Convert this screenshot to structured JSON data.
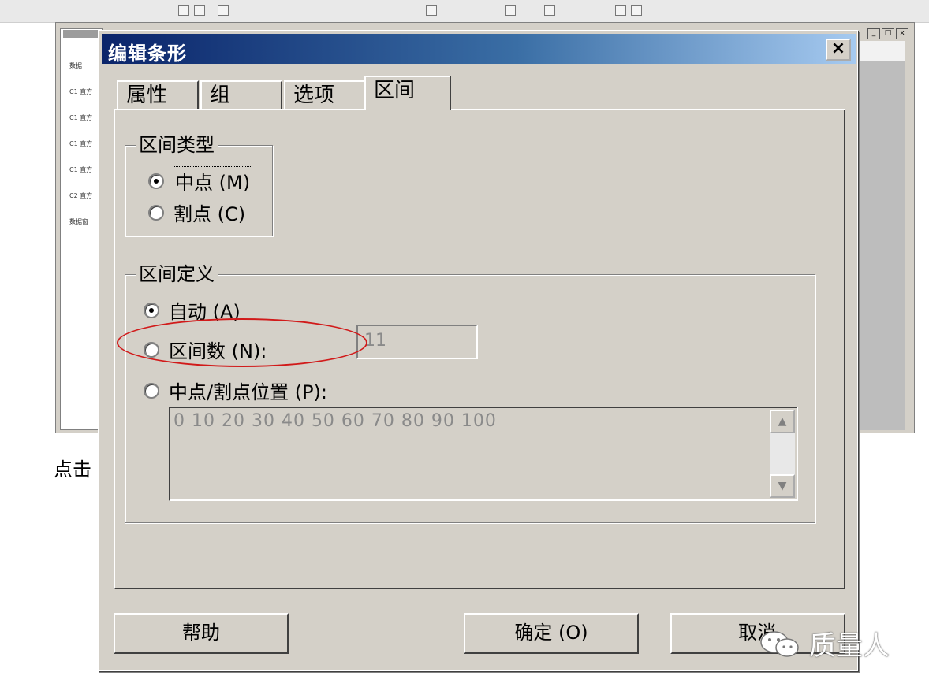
{
  "background": {
    "side_list": [
      "数据",
      "C1 直方",
      "C1 直方",
      "C1 直方",
      "C1 直方",
      "C2 直方",
      "数据窗"
    ],
    "window_buttons": [
      "_",
      "□",
      "x"
    ],
    "partial_text": "点击"
  },
  "dialog": {
    "title": "编辑条形",
    "close_glyph": "×",
    "tabs": [
      {
        "label": "属性"
      },
      {
        "label": "组"
      },
      {
        "label": "选项"
      },
      {
        "label": "区间",
        "active": true
      }
    ],
    "interval_type": {
      "legend": "区间类型",
      "options": [
        {
          "label_main": "中点",
          "label_hotkey": "(M)",
          "checked": true
        },
        {
          "label_main": "割点",
          "label_hotkey": "(C)",
          "checked": false
        }
      ]
    },
    "interval_definition": {
      "legend": "区间定义",
      "options": [
        {
          "label": "自动 (A)",
          "checked": true
        },
        {
          "label": "区间数 (N):",
          "checked": false
        },
        {
          "label": "中点/割点位置 (P):",
          "checked": false
        }
      ],
      "interval_count_value": "11",
      "positions_value": "0 10 20 30 40 50 60 70 80 90 100"
    },
    "buttons": {
      "help": "帮助",
      "ok": "确定 (O)",
      "cancel": "取消"
    }
  },
  "watermark": {
    "text": "质量人",
    "icon": "wechat-icon"
  },
  "colors": {
    "title_gradient_start": "#0a246a",
    "title_gradient_end": "#a6caf0",
    "highlight_ellipse": "#d11a1a",
    "dialog_face": "#d4d0c8"
  }
}
